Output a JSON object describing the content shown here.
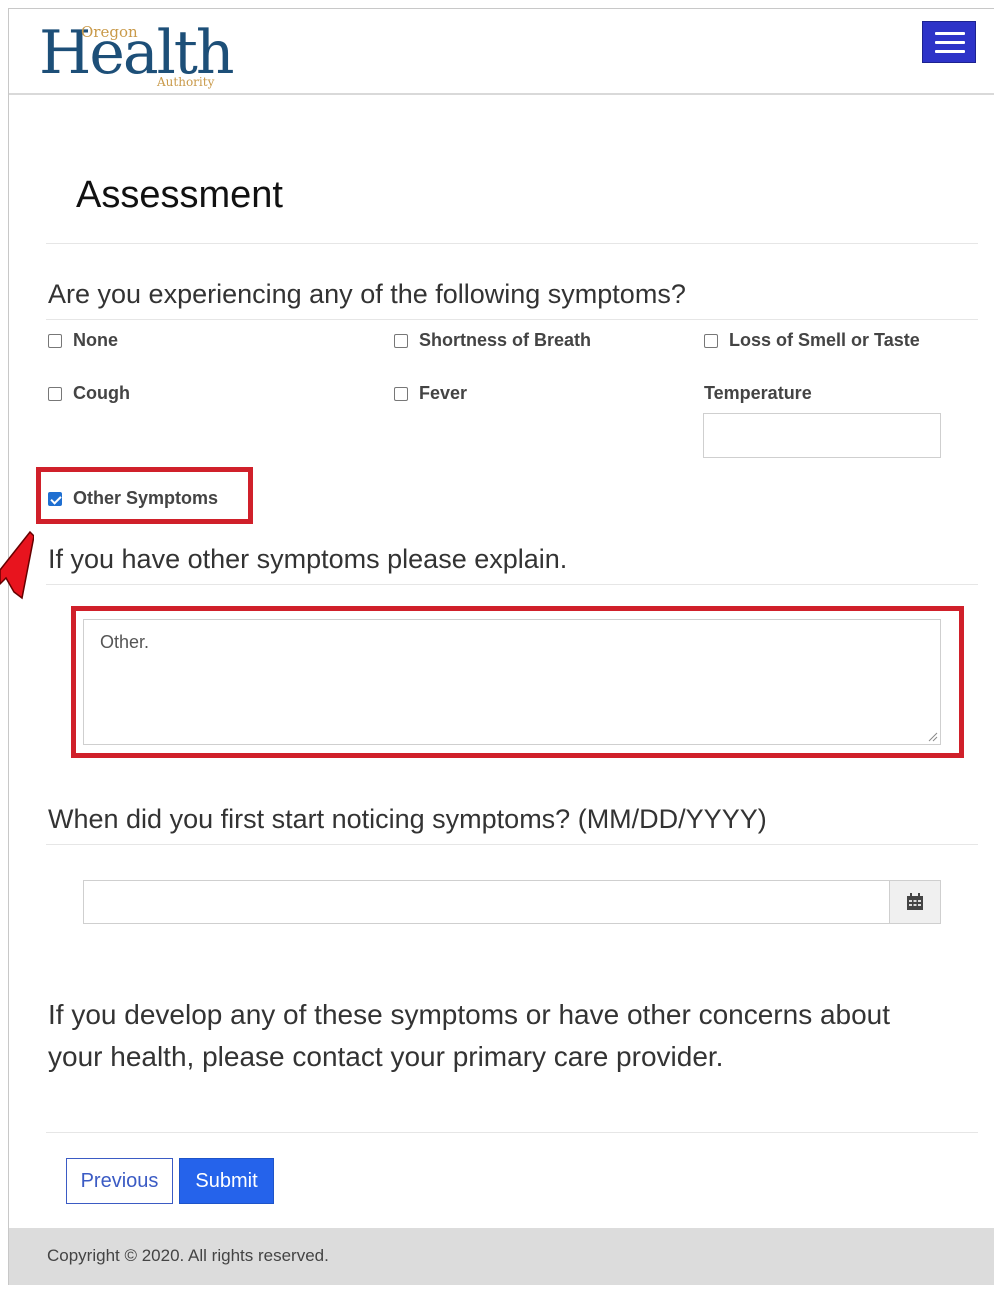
{
  "header": {
    "logo_main": "Health",
    "logo_top": "Oregon",
    "logo_bottom": "Authority"
  },
  "page": {
    "title": "Assessment"
  },
  "symptoms": {
    "question": "Are you experiencing any of the following symptoms?",
    "options": [
      {
        "label": "None",
        "checked": false
      },
      {
        "label": "Shortness of Breath",
        "checked": false
      },
      {
        "label": "Loss of Smell or Taste",
        "checked": false
      },
      {
        "label": "Cough",
        "checked": false
      },
      {
        "label": "Fever",
        "checked": false
      },
      {
        "label": "Other Symptoms",
        "checked": true
      }
    ],
    "temperature_label": "Temperature",
    "temperature_value": ""
  },
  "other": {
    "question": "If you have other symptoms please explain.",
    "value": "Other."
  },
  "onset": {
    "question": "When did you first start noticing symptoms? (MM/DD/YYYY)",
    "value": "",
    "calendar_icon": "calendar-icon"
  },
  "info_text": "If you develop any of these symptoms or have other concerns about your health, please contact your primary care provider.",
  "buttons": {
    "previous": "Previous",
    "submit": "Submit"
  },
  "footer": {
    "copyright": "Copyright © 2020. All rights reserved."
  },
  "colors": {
    "accent_blue": "#2d33c8",
    "button_blue": "#2563eb",
    "highlight_red": "#d0202a"
  }
}
